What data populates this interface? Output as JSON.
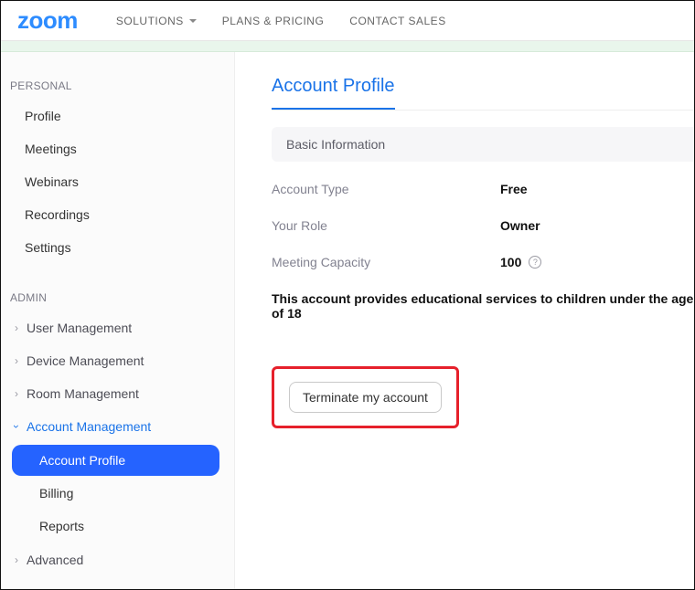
{
  "header": {
    "logo": "zoom",
    "nav": {
      "solutions": "SOLUTIONS",
      "plans": "PLANS & PRICING",
      "contact": "CONTACT SALES"
    }
  },
  "sidebar": {
    "personal_label": "PERSONAL",
    "personal": {
      "profile": "Profile",
      "meetings": "Meetings",
      "webinars": "Webinars",
      "recordings": "Recordings",
      "settings": "Settings"
    },
    "admin_label": "ADMIN",
    "admin": {
      "user_mgmt": "User Management",
      "device_mgmt": "Device Management",
      "room_mgmt": "Room Management",
      "account_mgmt": "Account Management",
      "account_profile": "Account Profile",
      "billing": "Billing",
      "reports": "Reports",
      "advanced": "Advanced"
    }
  },
  "main": {
    "title": "Account Profile",
    "panel_header": "Basic Information",
    "rows": {
      "account_type_label": "Account Type",
      "account_type_value": "Free",
      "role_label": "Your Role",
      "role_value": "Owner",
      "capacity_label": "Meeting Capacity",
      "capacity_value": "100"
    },
    "note": "This account provides educational services to children under the age of 18",
    "terminate_label": "Terminate my account"
  }
}
